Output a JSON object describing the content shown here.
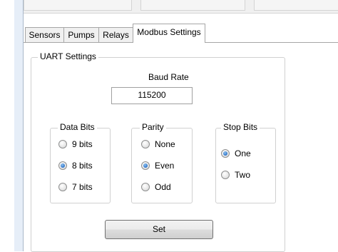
{
  "tabs": [
    {
      "label": "Sensors",
      "active": false
    },
    {
      "label": "Pumps",
      "active": false
    },
    {
      "label": "Relays",
      "active": false
    },
    {
      "label": "Modbus Settings",
      "active": true
    }
  ],
  "uart": {
    "legend": "UART Settings",
    "baud_rate_label": "Baud Rate",
    "baud_rate_value": "115200",
    "data_bits": {
      "legend": "Data Bits",
      "options": [
        {
          "label": "9 bits",
          "checked": false
        },
        {
          "label": "8 bits",
          "checked": true
        },
        {
          "label": "7 bits",
          "checked": false
        }
      ]
    },
    "parity": {
      "legend": "Parity",
      "options": [
        {
          "label": "None",
          "checked": false
        },
        {
          "label": "Even",
          "checked": true
        },
        {
          "label": "Odd",
          "checked": false
        }
      ]
    },
    "stop_bits": {
      "legend": "Stop Bits",
      "options": [
        {
          "label": "One",
          "checked": true
        },
        {
          "label": "Two",
          "checked": false
        }
      ]
    },
    "set_label": "Set"
  },
  "colors": {
    "radio_selected": "#2d72c8",
    "border": "#a6a6a6",
    "group_border": "#d0d0d0"
  }
}
